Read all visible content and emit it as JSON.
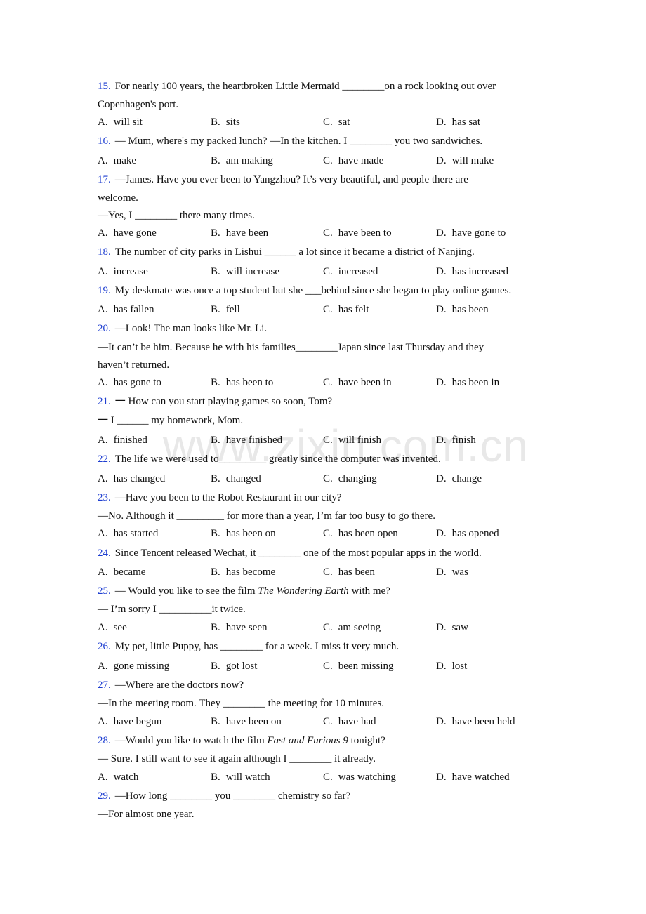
{
  "watermark": "www.zixin.com.cn",
  "questions": [
    {
      "num": "15.",
      "lines": [
        "For nearly 100 years, the heartbroken Little Mermaid ________on a rock looking out over",
        "Copenhagen's port."
      ],
      "options": [
        {
          "letter": "A.",
          "text": "will sit"
        },
        {
          "letter": "B.",
          "text": "sits"
        },
        {
          "letter": "C.",
          "text": "sat"
        },
        {
          "letter": "D.",
          "text": "has sat"
        }
      ]
    },
    {
      "num": "16.",
      "lines": [
        "— Mum, where's my packed lunch? —In the kitchen. I ________ you two sandwiches."
      ],
      "options": [
        {
          "letter": "A.",
          "text": "make"
        },
        {
          "letter": "B.",
          "text": "am making"
        },
        {
          "letter": "C.",
          "text": "have made"
        },
        {
          "letter": "D.",
          "text": "will make"
        }
      ]
    },
    {
      "num": "17.",
      "lines": [
        "—James. Have you ever been to Yangzhou? It’s very beautiful, and people there are",
        "welcome.",
        "—Yes, I ________ there many times."
      ],
      "options": [
        {
          "letter": "A.",
          "text": "have gone"
        },
        {
          "letter": "B.",
          "text": "have been"
        },
        {
          "letter": "C.",
          "text": "have been to"
        },
        {
          "letter": "D.",
          "text": "have gone to"
        }
      ]
    },
    {
      "num": "18.",
      "lines": [
        "The number of city parks in Lishui ______ a lot since it became a district of Nanjing."
      ],
      "options": [
        {
          "letter": "A.",
          "text": "increase"
        },
        {
          "letter": "B.",
          "text": "will increase"
        },
        {
          "letter": "C.",
          "text": "increased"
        },
        {
          "letter": "D.",
          "text": "has increased"
        }
      ]
    },
    {
      "num": "19.",
      "lines": [
        "My deskmate was once a top student but she ___behind since she began to play online games."
      ],
      "options": [
        {
          "letter": "A.",
          "text": "has fallen"
        },
        {
          "letter": "B.",
          "text": "fell"
        },
        {
          "letter": "C.",
          "text": "has felt"
        },
        {
          "letter": "D.",
          "text": "has been"
        }
      ]
    },
    {
      "num": "20.",
      "lines": [
        "—Look! The man looks like Mr. Li.",
        "—It can’t be him. Because he with his families________Japan since last Thursday and they",
        "haven’t returned."
      ],
      "options": [
        {
          "letter": "A.",
          "text": "has gone to"
        },
        {
          "letter": "B.",
          "text": "has been to"
        },
        {
          "letter": "C.",
          "text": "have been in"
        },
        {
          "letter": "D.",
          "text": "has been in"
        }
      ]
    },
    {
      "num": "21.",
      "lines": [
        "一 How can you start playing games so soon, Tom?",
        "一 I ______ my homework, Mom."
      ],
      "options": [
        {
          "letter": "A.",
          "text": "finished"
        },
        {
          "letter": "B.",
          "text": "have finished"
        },
        {
          "letter": "C.",
          "text": "will finish"
        },
        {
          "letter": "D.",
          "text": "finish"
        }
      ]
    },
    {
      "num": "22.",
      "lines": [
        "The life we were used to_________ greatly since the computer was invented."
      ],
      "options": [
        {
          "letter": "A.",
          "text": "has changed"
        },
        {
          "letter": "B.",
          "text": "changed"
        },
        {
          "letter": "C.",
          "text": "changing"
        },
        {
          "letter": "D.",
          "text": "change"
        }
      ]
    },
    {
      "num": "23.",
      "lines": [
        "—Have you been to the Robot Restaurant in our city?",
        "—No. Although it _________ for more than a year, I’m far too busy to go there."
      ],
      "options": [
        {
          "letter": "A.",
          "text": "has started"
        },
        {
          "letter": "B.",
          "text": "has been on"
        },
        {
          "letter": "C.",
          "text": "has been open"
        },
        {
          "letter": "D.",
          "text": "has opened"
        }
      ]
    },
    {
      "num": "24.",
      "lines": [
        "Since Tencent released Wechat, it ________ one of the most popular apps in the world."
      ],
      "options": [
        {
          "letter": "A.",
          "text": "became"
        },
        {
          "letter": "B.",
          "text": "has become"
        },
        {
          "letter": "C.",
          "text": "has been"
        },
        {
          "letter": "D.",
          "text": "was"
        }
      ]
    },
    {
      "num": "25.",
      "lines_rich": [
        [
          {
            "t": "— Would you like to see the film "
          },
          {
            "t": "The Wondering Earth",
            "i": true
          },
          {
            "t": " with me?"
          }
        ],
        [
          {
            "t": "— I’m sorry I __________it twice."
          }
        ]
      ],
      "options": [
        {
          "letter": "A.",
          "text": "see"
        },
        {
          "letter": "B.",
          "text": "have seen"
        },
        {
          "letter": "C.",
          "text": "am seeing"
        },
        {
          "letter": "D.",
          "text": "saw"
        }
      ]
    },
    {
      "num": "26.",
      "lines": [
        "My pet, little Puppy, has ________ for a week. I miss it very much."
      ],
      "options": [
        {
          "letter": "A.",
          "text": "gone missing"
        },
        {
          "letter": "B.",
          "text": "got lost"
        },
        {
          "letter": "C.",
          "text": "been missing"
        },
        {
          "letter": "D.",
          "text": "lost"
        }
      ]
    },
    {
      "num": "27.",
      "lines": [
        "—Where are the doctors now?",
        "—In the meeting room. They ________ the meeting for 10 minutes."
      ],
      "options": [
        {
          "letter": "A.",
          "text": "have begun"
        },
        {
          "letter": "B.",
          "text": "have been on"
        },
        {
          "letter": "C.",
          "text": "have had"
        },
        {
          "letter": "D.",
          "text": "have been held"
        }
      ]
    },
    {
      "num": "28.",
      "lines_rich": [
        [
          {
            "t": "—Would you like to watch the film "
          },
          {
            "t": "Fast and Furious 9",
            "i": true
          },
          {
            "t": " tonight?"
          }
        ],
        [
          {
            "t": "— Sure. I still want to see it again although I ________ it already."
          }
        ]
      ],
      "options": [
        {
          "letter": "A.",
          "text": "watch"
        },
        {
          "letter": "B.",
          "text": "will watch"
        },
        {
          "letter": "C.",
          "text": "was watching"
        },
        {
          "letter": "D.",
          "text": "have watched"
        }
      ]
    },
    {
      "num": "29.",
      "lines": [
        "—How long ________ you ________ chemistry so far?",
        "—For almost one year."
      ],
      "options": []
    }
  ]
}
